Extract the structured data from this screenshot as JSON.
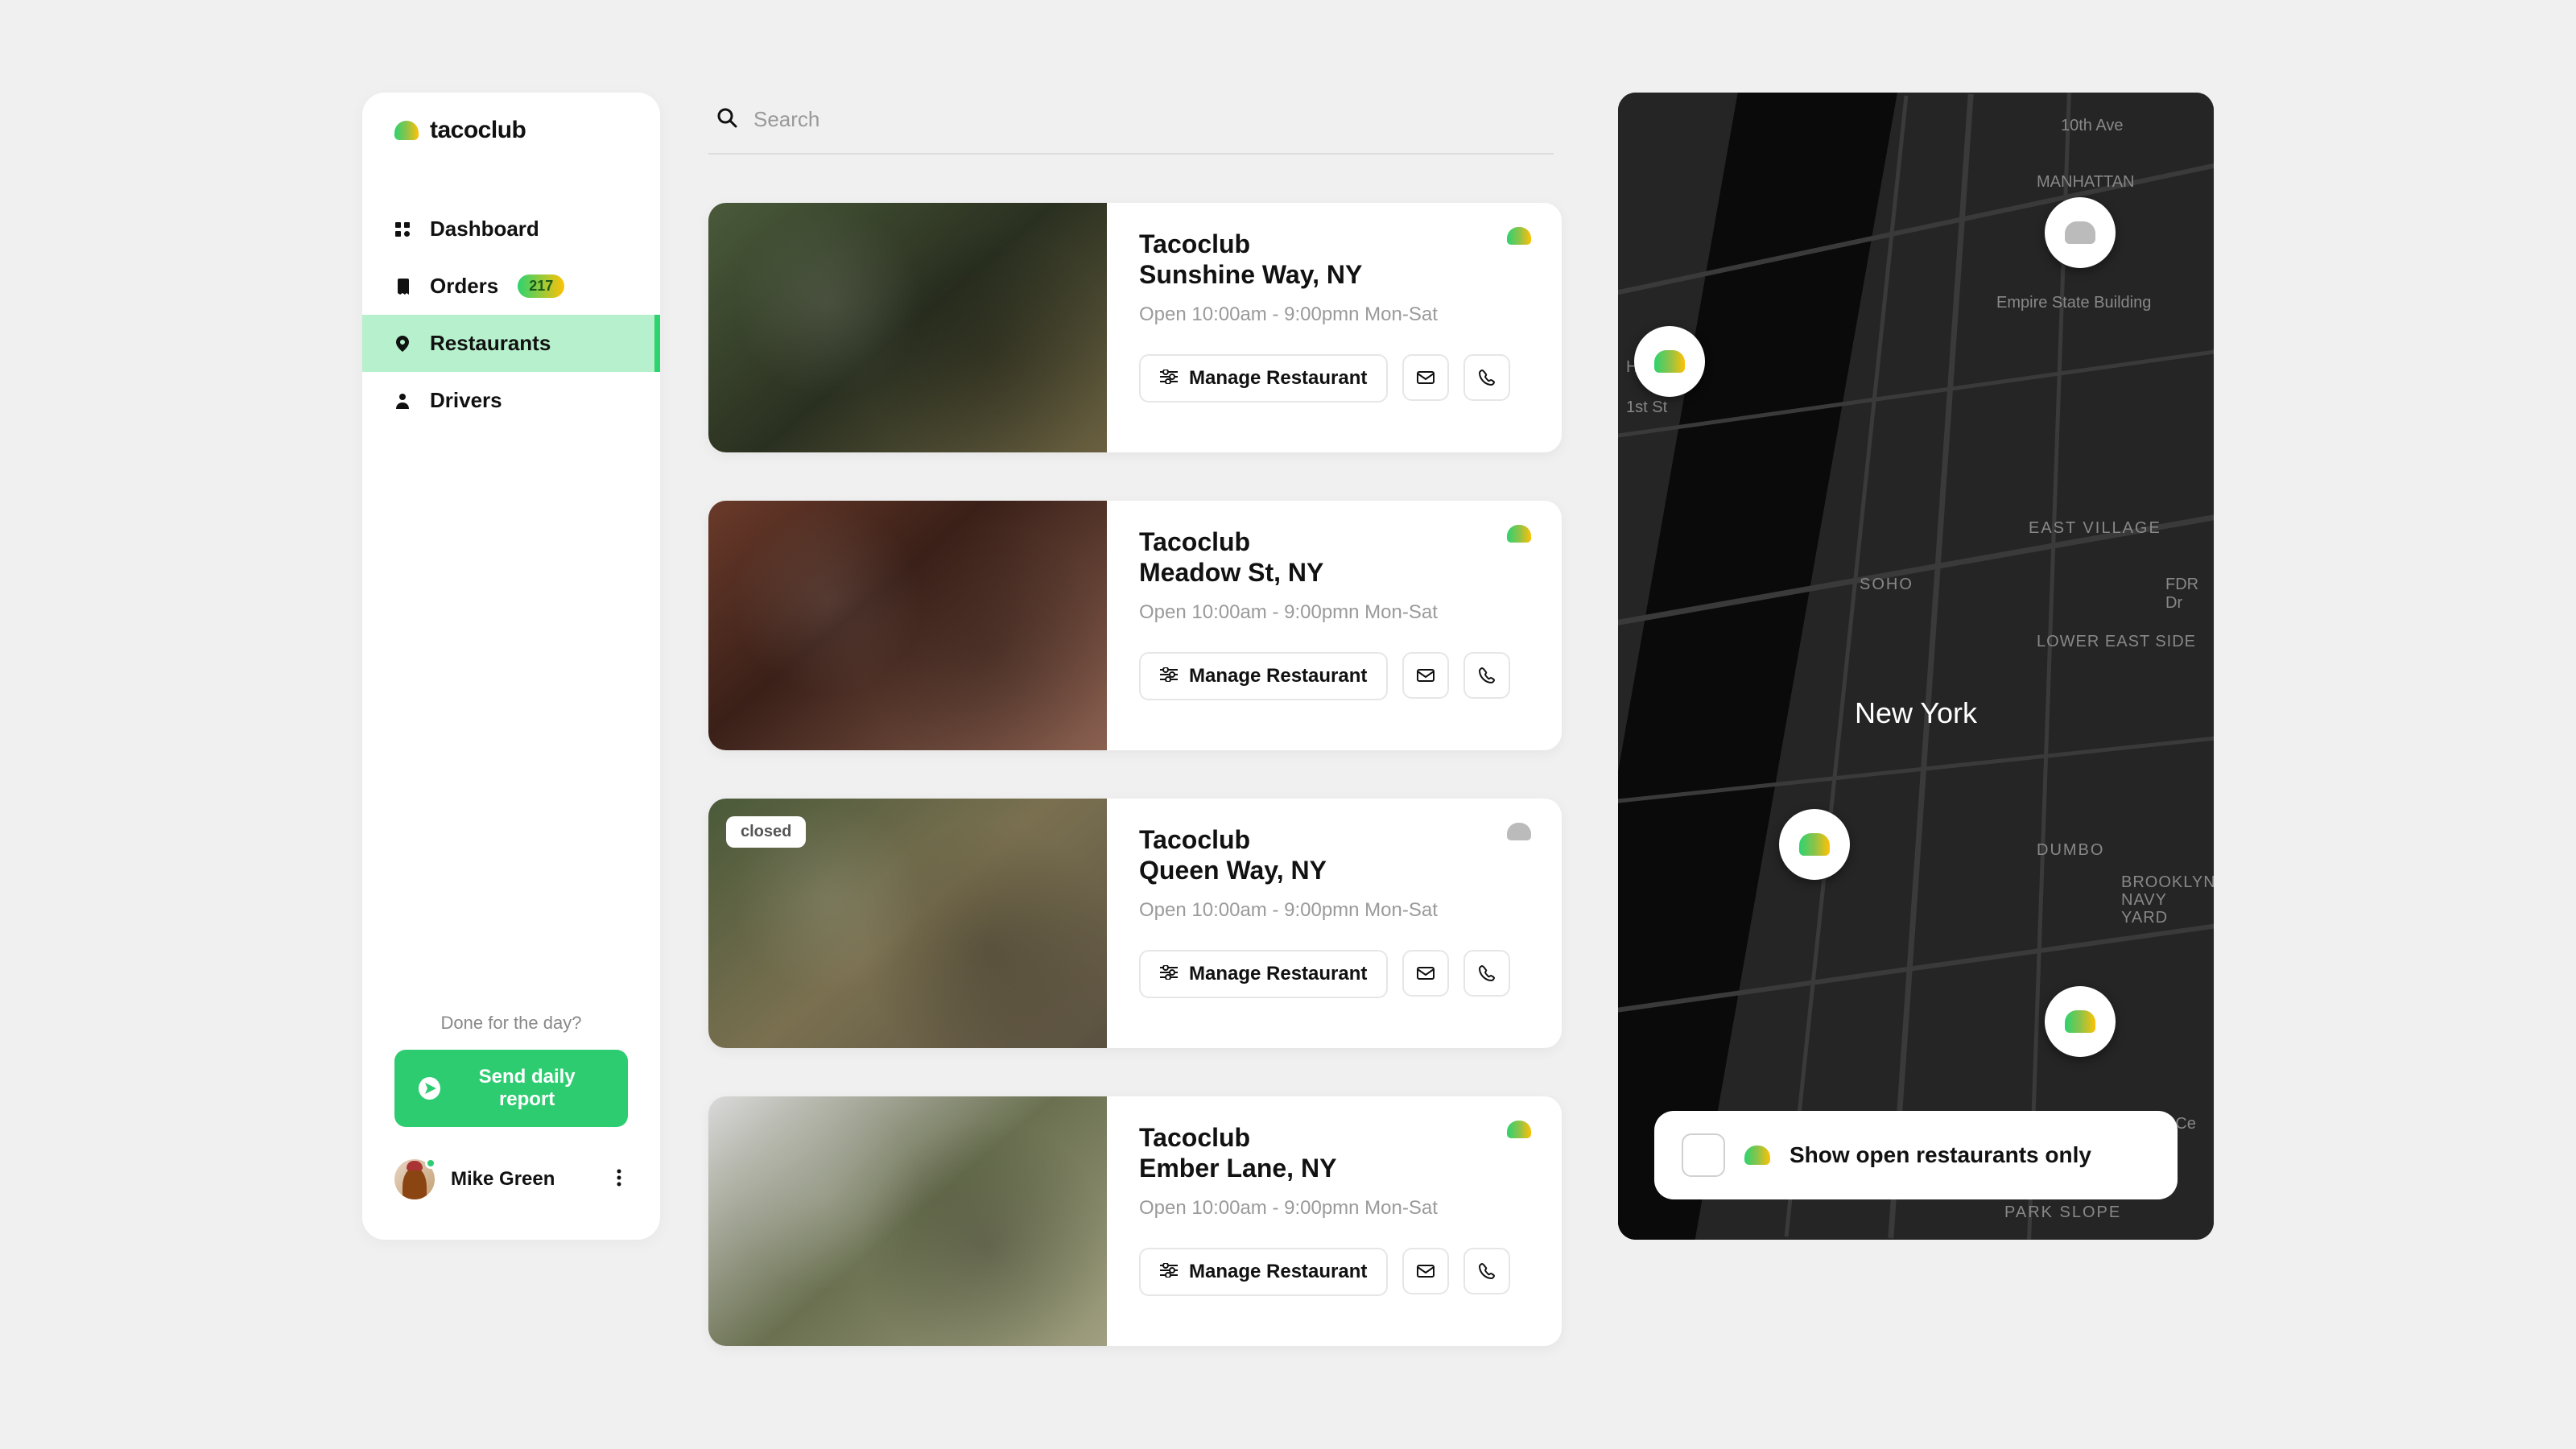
{
  "brand": "tacoclub",
  "nav": {
    "items": [
      {
        "label": "Dashboard",
        "icon": "grid"
      },
      {
        "label": "Orders",
        "icon": "receipt",
        "badge": "217"
      },
      {
        "label": "Restaurants",
        "icon": "pin",
        "active": true
      },
      {
        "label": "Drivers",
        "icon": "person"
      }
    ]
  },
  "sidebar": {
    "done_prompt": "Done for the day?",
    "report_button": "Send daily report"
  },
  "user": {
    "name": "Mike Green"
  },
  "search": {
    "placeholder": "Search"
  },
  "restaurants": [
    {
      "brand": "Tacoclub",
      "address": "Sunshine Way, NY",
      "hours": "Open 10:00am - 9:00pmn Mon-Sat",
      "manage": "Manage Restaurant",
      "open": true
    },
    {
      "brand": "Tacoclub",
      "address": "Meadow St, NY",
      "hours": "Open 10:00am - 9:00pmn Mon-Sat",
      "manage": "Manage Restaurant",
      "open": true
    },
    {
      "brand": "Tacoclub",
      "address": "Queen Way, NY",
      "hours": "Open 10:00am - 9:00pmn Mon-Sat",
      "manage": "Manage Restaurant",
      "open": false,
      "closed_label": "closed"
    },
    {
      "brand": "Tacoclub",
      "address": "Ember Lane, NY",
      "hours": "Open 10:00am - 9:00pmn Mon-Sat",
      "manage": "Manage Restaurant",
      "open": true
    }
  ],
  "map": {
    "city": "New York",
    "labels": {
      "hoboken": "Hoboken",
      "esb": "Empire State Building",
      "east_village": "EAST VILLAGE",
      "soho": "SOHO",
      "les": "LOWER EAST SIDE",
      "dumbo": "DUMBO",
      "bny": "BROOKLYN NAVY YARD",
      "barclays": "Barclays Ce",
      "park_slope": "PARK SLOPE",
      "first": "1st St",
      "tenth": "10th Ave",
      "fdr": "FDR Dr",
      "manhattan": "MANHATTAN"
    },
    "filter_label": "Show open restaurants only"
  }
}
